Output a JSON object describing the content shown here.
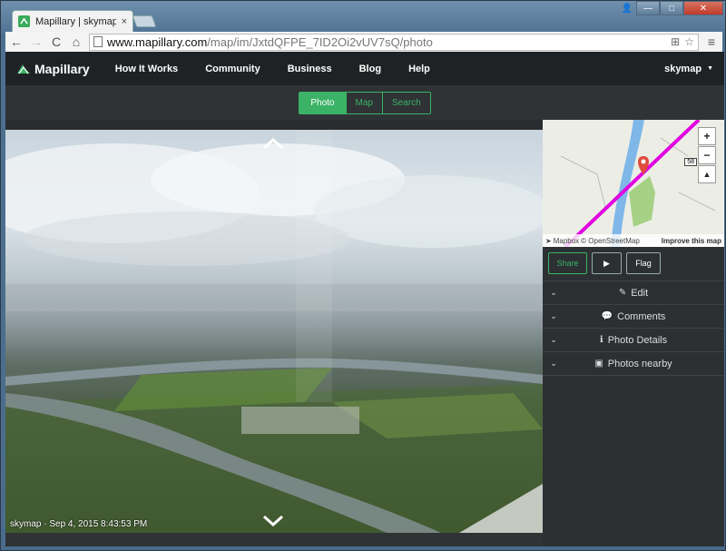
{
  "browser": {
    "tab_title": "Mapillary | skymap's ph",
    "tab_close": "×",
    "url_host": "www.mapillary.com",
    "url_path": "/map/im/JxtdQFPE_7ID2Oi2vUV7sQ/photo",
    "nav": {
      "back": "←",
      "forward": "→",
      "reload": "C",
      "home": "⌂"
    },
    "omnibox_icons": {
      "translate": "⊞",
      "star": "☆",
      "menu": "≡"
    },
    "window_controls": {
      "user": "👤",
      "minimize": "—",
      "maximize": "□",
      "close": "✕"
    }
  },
  "site": {
    "logo_text": "Mapillary",
    "brand_color": "#3bb266",
    "nav_items": [
      "How It Works",
      "Community",
      "Business",
      "Blog",
      "Help"
    ],
    "user_name": "skymap",
    "user_caret": "▼",
    "view_tabs": [
      "Photo",
      "Map",
      "Search"
    ],
    "active_tab": "Photo"
  },
  "photo": {
    "caption": "skymap · Sep 4, 2015 8:43:53 PM"
  },
  "map": {
    "zoom_in": "+",
    "zoom_out": "−",
    "compass": "▲",
    "route_shield": "58",
    "attribution_mapbox": "Mapbox",
    "attribution_osm": "© OpenStreetMap",
    "improve_link": "Improve this map"
  },
  "actions": {
    "share": "Share",
    "play": "▶",
    "flag": "Flag"
  },
  "panels": [
    {
      "icon": "✎",
      "icon_name": "pencil-icon",
      "label": "Edit",
      "chevron": "⌄"
    },
    {
      "icon": "💬",
      "icon_name": "comments-icon",
      "label": "Comments",
      "chevron": "⌄"
    },
    {
      "icon": "ℹ",
      "icon_name": "info-icon",
      "label": "Photo Details",
      "chevron": "⌄"
    },
    {
      "icon": "▣",
      "icon_name": "image-icon",
      "label": "Photos nearby",
      "chevron": "⌄"
    }
  ]
}
